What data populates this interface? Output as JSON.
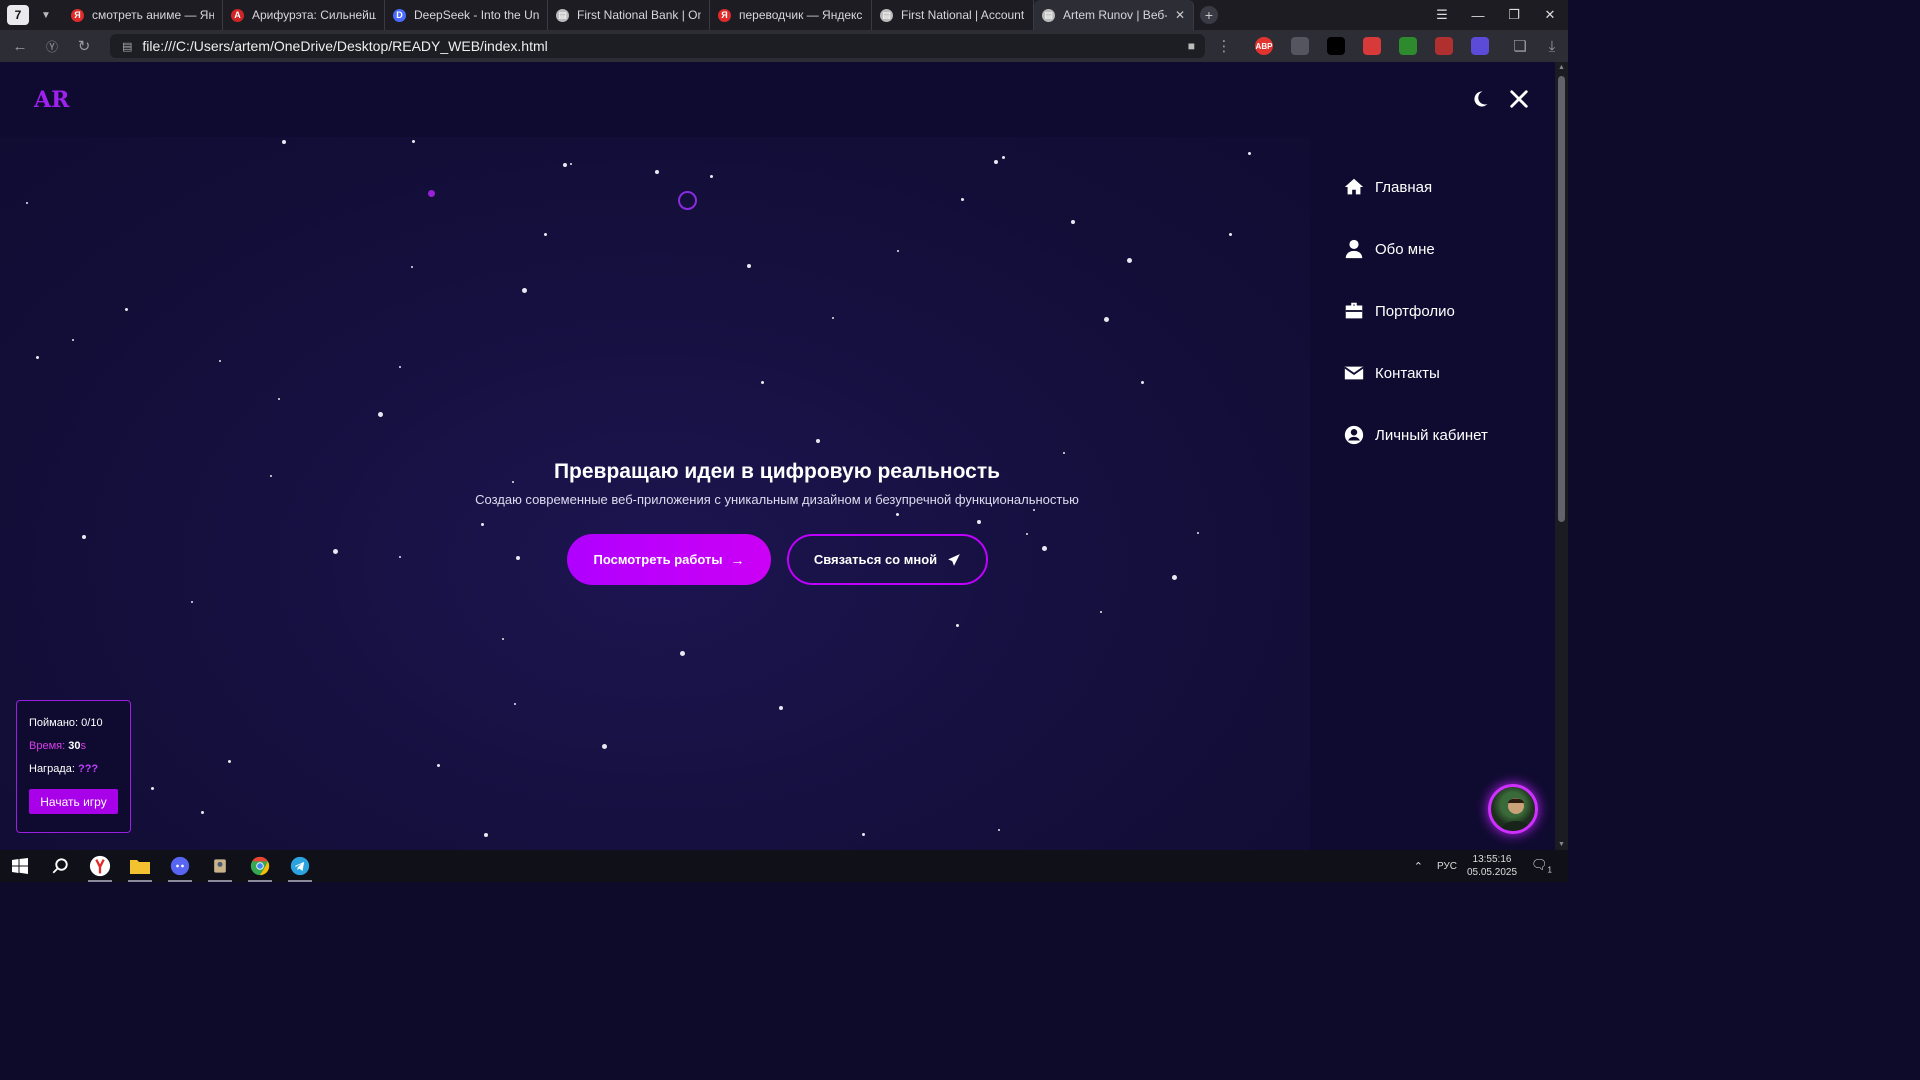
{
  "browser": {
    "tab_count": "7",
    "tabs": [
      {
        "title": "смотреть аниме — Яндекс",
        "icon_color": "#e02b2b",
        "icon_letter": "Я"
      },
      {
        "title": "Арифурэта: Сильнейший",
        "icon_color": "#d02525",
        "icon_letter": "A"
      },
      {
        "title": "DeepSeek - Into the Unkno",
        "icon_color": "#4b6bff",
        "icon_letter": "D"
      },
      {
        "title": "First National Bank | Onlin",
        "icon_color": "#bbbbbb",
        "icon_letter": "▤"
      },
      {
        "title": "переводчик — Яндекс: на",
        "icon_color": "#e02b2b",
        "icon_letter": "Я"
      },
      {
        "title": "First National | Account",
        "icon_color": "#bbbbbb",
        "icon_letter": "▤"
      },
      {
        "title": "Artem Runov | Веб-раз",
        "icon_color": "#bbbbbb",
        "icon_letter": "▤",
        "active": true
      }
    ],
    "url": "file:///C:/Users/artem/OneDrive/Desktop/READY_WEB/index.html",
    "extensions": [
      {
        "name": "adblock-icon",
        "label": "ABP",
        "color": "#e2342e"
      },
      {
        "name": "circle-ext-icon",
        "label": "",
        "color": "#555560"
      },
      {
        "name": "pen-ext-icon",
        "label": "",
        "color": "#000000"
      },
      {
        "name": "lock-ext-icon",
        "label": "",
        "color": "#d83a3a"
      },
      {
        "name": "chart-ext-icon",
        "label": "",
        "color": "#2d8a2d"
      },
      {
        "name": "wave-ext-icon",
        "label": "",
        "color": "#b03030"
      },
      {
        "name": "chat-ext-icon",
        "label": "",
        "color": "#5b4bd8"
      }
    ]
  },
  "site": {
    "logo": "AR",
    "hero": {
      "title": "Превращаю идеи в цифровую реальность",
      "subtitle": "Создаю современные веб-приложения с уникальным дизайном и безупречной функциональностью",
      "primary_button": "Посмотреть работы",
      "secondary_button": "Связаться со мной"
    },
    "menu": [
      {
        "label": "Главная",
        "icon": "home-icon"
      },
      {
        "label": "Обо мне",
        "icon": "user-icon"
      },
      {
        "label": "Портфолио",
        "icon": "briefcase-icon"
      },
      {
        "label": "Контакты",
        "icon": "envelope-icon"
      },
      {
        "label": "Личный кабинет",
        "icon": "user-circle-icon"
      }
    ],
    "game": {
      "caught_label": "Поймано:",
      "caught_value": "0/10",
      "time_label": "Время:",
      "time_value": "30",
      "time_unit": "s",
      "reward_label": "Награда:",
      "reward_value": "???",
      "start_button": "Начать игру"
    },
    "colors": {
      "accent": "#b000ff",
      "background": "#0f0b30"
    }
  },
  "taskbar": {
    "language": "РУС",
    "time": "13:55:16",
    "date": "05.05.2025",
    "notifications": "1"
  }
}
